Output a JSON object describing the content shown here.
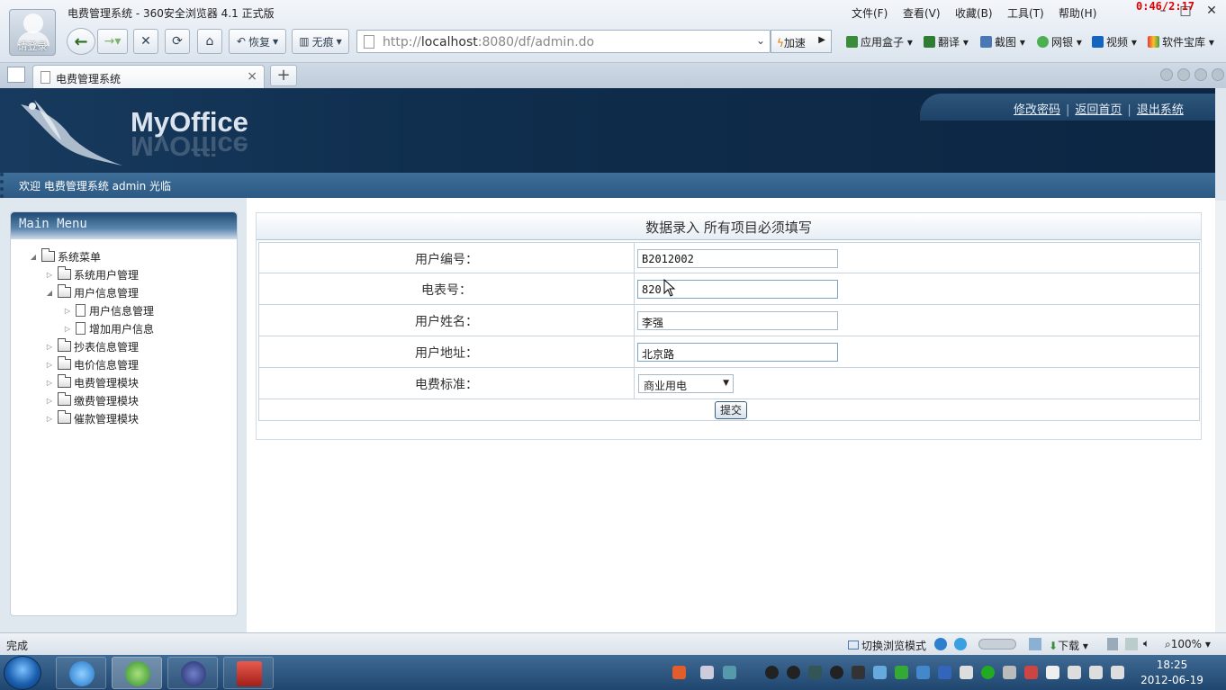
{
  "browser": {
    "window_title": "电费管理系统 - 360安全浏览器 4.1 正式版",
    "login_label": "请登录",
    "menus": [
      "文件(F)",
      "查看(V)",
      "收藏(B)",
      "工具(T)",
      "帮助(H)"
    ],
    "timer": "0:46/2:17",
    "nav": {
      "restore": "恢复",
      "incognito": "无痕"
    },
    "address": {
      "host_prefix": "http://",
      "host": "localhost",
      "path": ":8080/df/admin.do"
    },
    "speedup": "加速",
    "toolbar": [
      "应用盒子",
      "翻译",
      "截图",
      "网银",
      "视频",
      "软件宝库"
    ],
    "tab_title": "电费管理系统",
    "status_text": "完成",
    "browse_mode": "切换浏览模式",
    "download": "下载",
    "zoom": "100%"
  },
  "site": {
    "logo": "MyOffice",
    "top_links": [
      "修改密码",
      "返回首页",
      "退出系统"
    ],
    "welcome": "欢迎 电费管理系统 admin 光临",
    "main_menu_title": "Main Menu",
    "tree": [
      {
        "label": "系统菜单",
        "level": 0,
        "type": "folder",
        "expanded": true
      },
      {
        "label": "系统用户管理",
        "level": 1,
        "type": "folder",
        "expanded": false
      },
      {
        "label": "用户信息管理",
        "level": 1,
        "type": "folder",
        "expanded": true
      },
      {
        "label": "用户信息管理",
        "level": 2,
        "type": "doc"
      },
      {
        "label": "增加用户信息",
        "level": 2,
        "type": "doc"
      },
      {
        "label": "抄表信息管理",
        "level": 1,
        "type": "folder",
        "expanded": false
      },
      {
        "label": "电价信息管理",
        "level": 1,
        "type": "folder",
        "expanded": false
      },
      {
        "label": "电费管理模块",
        "level": 1,
        "type": "folder",
        "expanded": false
      },
      {
        "label": "缴费管理模块",
        "level": 1,
        "type": "folder",
        "expanded": false
      },
      {
        "label": "催款管理模块",
        "level": 1,
        "type": "folder",
        "expanded": false
      }
    ]
  },
  "form": {
    "title": "数据录入  所有项目必须填写",
    "fields": [
      {
        "label": "用户编号：",
        "value": "B2012002"
      },
      {
        "label": "电表号：",
        "value": "820"
      },
      {
        "label": "用户姓名：",
        "value": "李强"
      },
      {
        "label": "用户地址：",
        "value": "北京路"
      },
      {
        "label": "电费标准：",
        "value": "商业用电"
      }
    ],
    "submit": "提交"
  },
  "taskbar": {
    "time": "18:25",
    "date": "2012-06-19"
  }
}
